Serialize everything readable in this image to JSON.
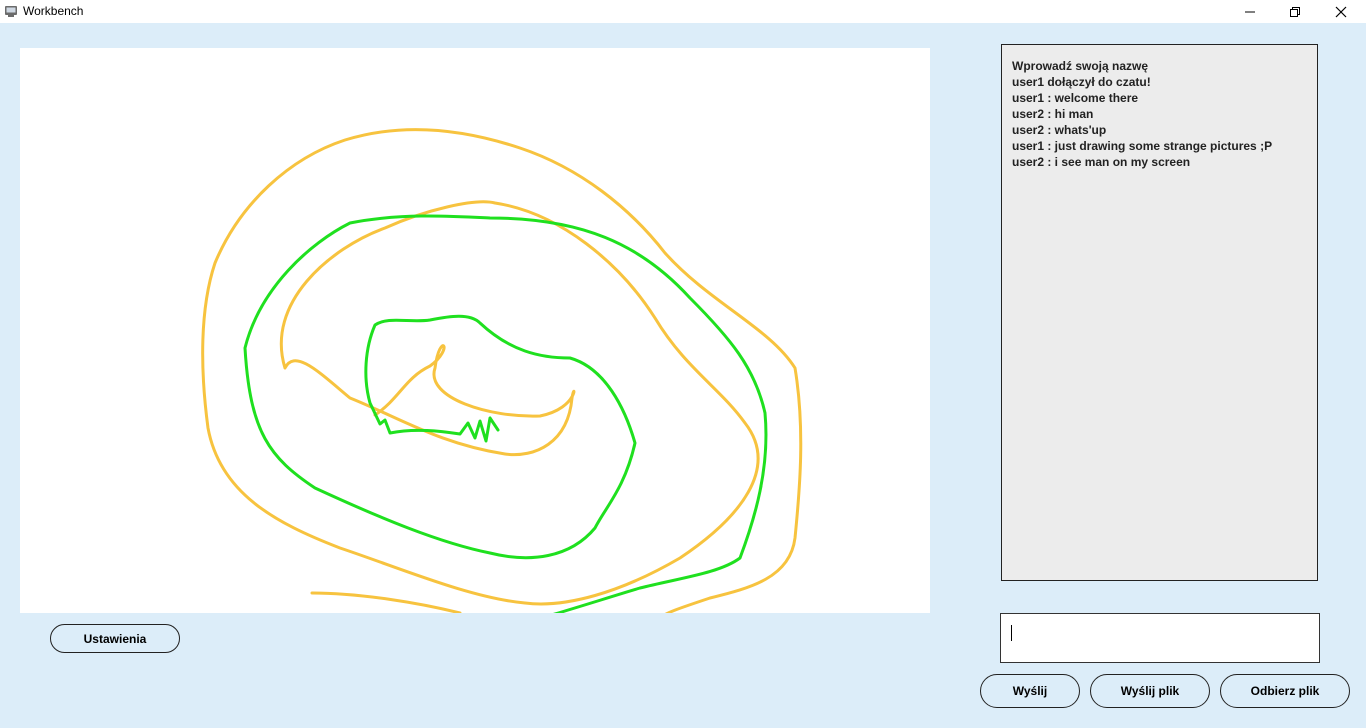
{
  "window": {
    "title": "Workbench",
    "icon": "app-window-icon",
    "controls": [
      "minimize-icon",
      "restore-icon",
      "close-icon"
    ]
  },
  "canvas": {
    "strokes": [
      {
        "color": "#f7c33f",
        "name": "yellow-spiral-stroke"
      },
      {
        "color": "#1fe01f",
        "name": "green-spiral-stroke"
      }
    ]
  },
  "chat": {
    "messages": [
      "Wprowadź swoją nazwę",
      "user1 dołączył do czatu!",
      "user1 : welcome there",
      "user2 : hi man",
      "user2 : whats'up",
      "user1 : just drawing some strange pictures ;P",
      "user2 : i see man on my screen"
    ],
    "input_value": ""
  },
  "buttons": {
    "settings": "Ustawienia",
    "send": "Wyślij",
    "send_file": "Wyślij plik",
    "receive_file": "Odbierz plik"
  }
}
